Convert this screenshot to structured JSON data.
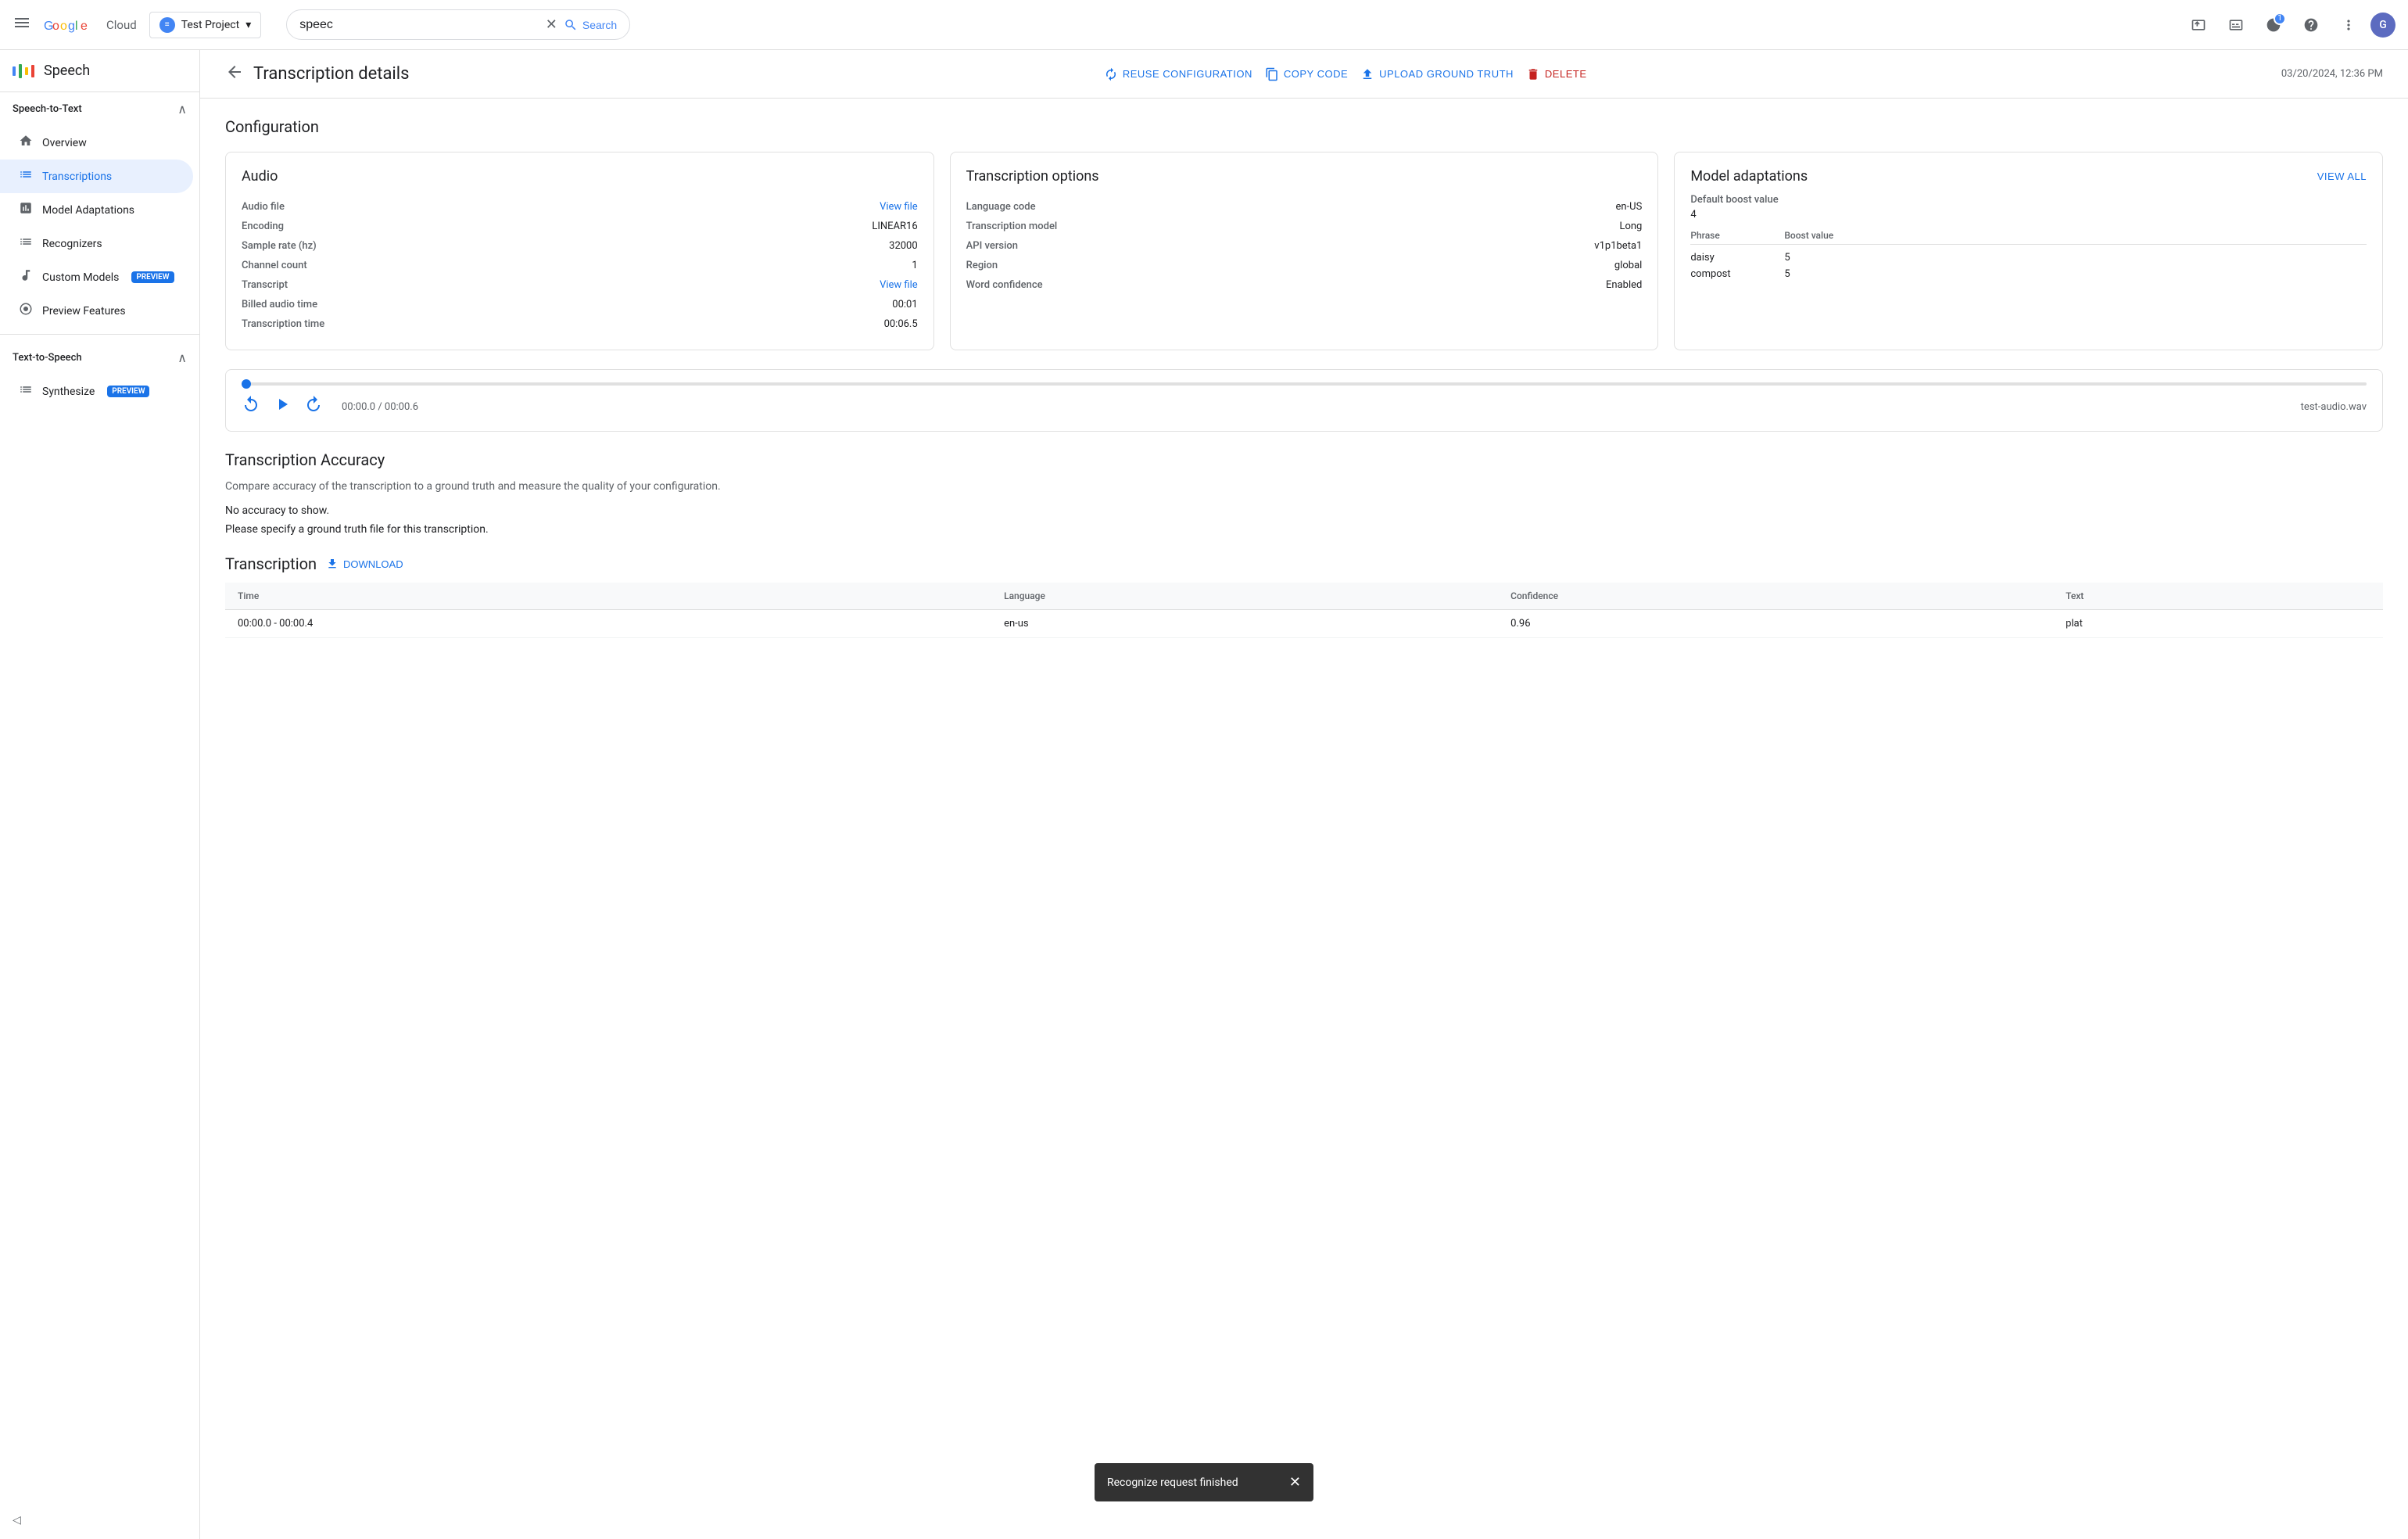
{
  "navbar": {
    "hamburger_label": "☰",
    "logo_text": "Google Cloud",
    "project": {
      "name": "Test Project",
      "dropdown_icon": "▾"
    },
    "search": {
      "value": "speec",
      "placeholder": "Search",
      "clear_icon": "✕",
      "button_label": "Search"
    },
    "icons": {
      "terminal": "⬚",
      "cloud_shell": "▷",
      "notification_count": "1",
      "help": "?",
      "more": "⋮"
    },
    "user_initial": "G"
  },
  "sidebar": {
    "app_name": "Speech",
    "speech_to_text": {
      "section_label": "Speech-to-Text",
      "items": [
        {
          "id": "overview",
          "label": "Overview",
          "icon": "🏠"
        },
        {
          "id": "transcriptions",
          "label": "Transcriptions",
          "icon": "≡",
          "active": true
        },
        {
          "id": "model-adaptations",
          "label": "Model Adaptations",
          "icon": "📊"
        },
        {
          "id": "recognizers",
          "label": "Recognizers",
          "icon": "≡"
        },
        {
          "id": "custom-models",
          "label": "Custom Models",
          "icon": "🔊",
          "badge": "PREVIEW"
        },
        {
          "id": "preview-features",
          "label": "Preview Features",
          "icon": "⊙"
        }
      ]
    },
    "text_to_speech": {
      "section_label": "Text-to-Speech",
      "items": [
        {
          "id": "synthesize",
          "label": "Synthesize",
          "icon": "≡",
          "badge": "PREVIEW"
        }
      ]
    },
    "collapse_label": "◁"
  },
  "page_header": {
    "back_icon": "←",
    "title": "Transcription details",
    "actions": [
      {
        "id": "reuse-config",
        "label": "REUSE CONFIGURATION",
        "icon": "↺",
        "color": "primary"
      },
      {
        "id": "copy-code",
        "label": "COPY CODE",
        "icon": "⎘",
        "color": "primary"
      },
      {
        "id": "upload-ground-truth",
        "label": "UPLOAD GROUND TRUTH",
        "icon": "↑",
        "color": "primary"
      },
      {
        "id": "delete",
        "label": "DELETE",
        "icon": "🗑",
        "color": "danger"
      }
    ],
    "timestamp": "03/20/2024, 12:36 PM"
  },
  "configuration": {
    "section_title": "Configuration",
    "audio_card": {
      "title": "Audio",
      "rows": [
        {
          "label": "Audio file",
          "value": "View file",
          "is_link": true
        },
        {
          "label": "Encoding",
          "value": "LINEAR16",
          "is_link": false
        },
        {
          "label": "Sample rate (hz)",
          "value": "32000",
          "is_link": false
        },
        {
          "label": "Channel count",
          "value": "1",
          "is_link": false
        },
        {
          "label": "Transcript",
          "value": "View file",
          "is_link": true
        },
        {
          "label": "Billed audio time",
          "value": "00:01",
          "is_link": false
        },
        {
          "label": "Transcription time",
          "value": "00:06.5",
          "is_link": false
        }
      ]
    },
    "transcription_options_card": {
      "title": "Transcription options",
      "rows": [
        {
          "label": "Language code",
          "value": "en-US"
        },
        {
          "label": "Transcription model",
          "value": "Long"
        },
        {
          "label": "API version",
          "value": "v1p1beta1"
        },
        {
          "label": "Region",
          "value": "global"
        },
        {
          "label": "Word confidence",
          "value": "Enabled"
        }
      ]
    },
    "model_adaptations_card": {
      "title": "Model adaptations",
      "view_all_label": "VIEW ALL",
      "default_boost_label": "Default boost value",
      "default_boost_value": "4",
      "table_headers": [
        "Phrase",
        "Boost value"
      ],
      "table_rows": [
        {
          "phrase": "daisy",
          "boost": "5"
        },
        {
          "phrase": "compost",
          "boost": "5"
        }
      ]
    }
  },
  "audio_player": {
    "progress_percent": 0,
    "time_display": "00:00.0 / 00:00.6",
    "filename": "test-audio.wav",
    "rewind_icon": "↺",
    "play_icon": "▶",
    "forward_icon": "↻"
  },
  "transcription_accuracy": {
    "title": "Transcription Accuracy",
    "description": "Compare accuracy of the transcription to a ground truth and measure the quality of your configuration.",
    "no_accuracy": "No accuracy to show.",
    "ground_truth_note": "Please specify a ground truth file for this transcription."
  },
  "transcription_table": {
    "title": "Transcription",
    "download_label": "DOWNLOAD",
    "download_icon": "↓",
    "headers": [
      "Time",
      "Language",
      "Confidence",
      "Text"
    ],
    "rows": [
      {
        "time": "00:00.0 - 00:00.4",
        "language": "en-us",
        "confidence": "0.96",
        "text": "plat"
      }
    ]
  },
  "snackbar": {
    "message": "Recognize request finished",
    "close_icon": "✕"
  },
  "colors": {
    "primary": "#1a73e8",
    "danger": "#c5221f",
    "active_bg": "#e8f0fe",
    "border": "#e0e0e0",
    "text_secondary": "#5f6368"
  }
}
